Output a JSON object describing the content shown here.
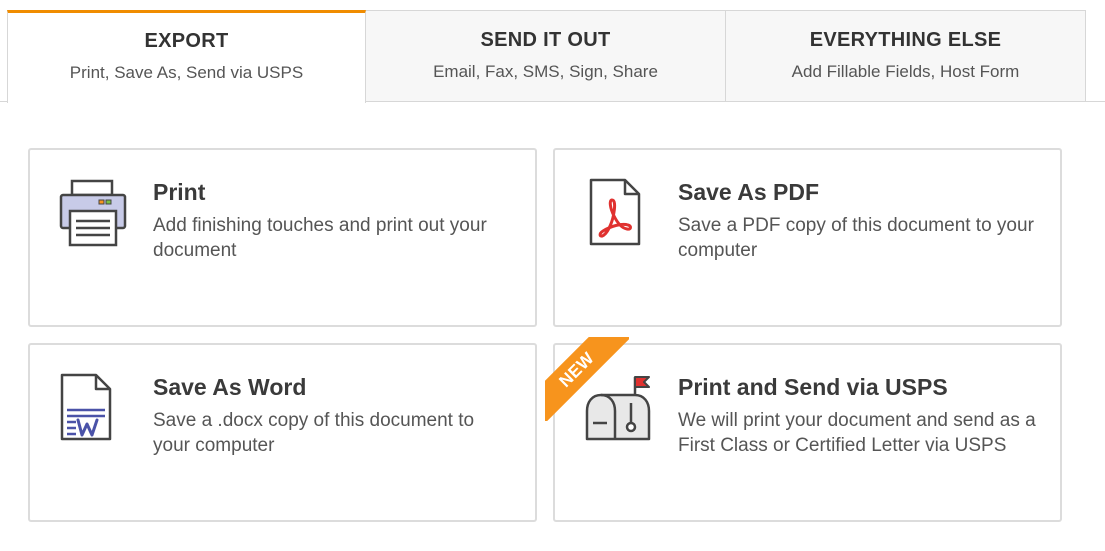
{
  "tabs": [
    {
      "title": "EXPORT",
      "subtitle": "Print, Save As, Send via USPS",
      "active": true
    },
    {
      "title": "SEND IT OUT",
      "subtitle": "Email, Fax, SMS, Sign, Share",
      "active": false
    },
    {
      "title": "EVERYTHING ELSE",
      "subtitle": "Add Fillable Fields, Host Form",
      "active": false
    }
  ],
  "accent_color": "#f08c00",
  "cards": {
    "print": {
      "title": "Print",
      "description": "Add finishing touches and print out your document",
      "icon": "printer-icon"
    },
    "pdf": {
      "title": "Save As PDF",
      "description": "Save a PDF copy of this document to your computer",
      "icon": "pdf-file-icon"
    },
    "word": {
      "title": "Save As Word",
      "description": "Save a .docx copy of this document to your computer",
      "icon": "word-file-icon"
    },
    "usps": {
      "title": "Print and Send via USPS",
      "description": "We will print your document and send as a First Class or Certified Letter via USPS",
      "icon": "mailbox-icon",
      "badge": "NEW"
    }
  }
}
